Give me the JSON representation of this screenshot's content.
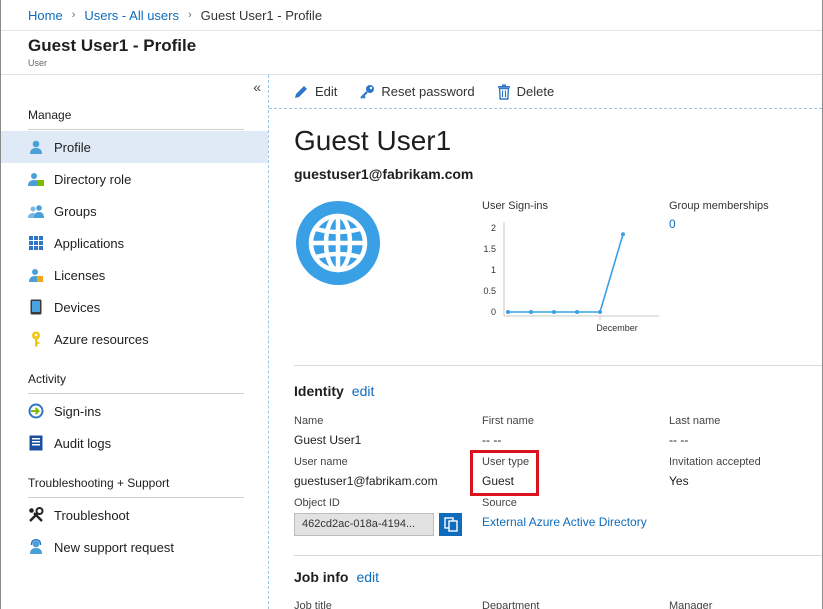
{
  "breadcrumb": {
    "home": "Home",
    "users": "Users - All users",
    "current": "Guest User1 - Profile",
    "separator": "›"
  },
  "header": {
    "title": "Guest User1 - Profile",
    "subtitle": "User"
  },
  "sidebar": {
    "collapse_label": "«",
    "sections": [
      {
        "title": "Manage"
      },
      {
        "title": "Activity"
      },
      {
        "title": "Troubleshooting + Support"
      }
    ],
    "items": [
      {
        "label": "Profile",
        "icon": "user-icon",
        "active": true
      },
      {
        "label": "Directory role",
        "icon": "role-icon"
      },
      {
        "label": "Groups",
        "icon": "groups-icon"
      },
      {
        "label": "Applications",
        "icon": "apps-grid-icon"
      },
      {
        "label": "Licenses",
        "icon": "license-icon"
      },
      {
        "label": "Devices",
        "icon": "device-icon"
      },
      {
        "label": "Azure resources",
        "icon": "key-icon"
      },
      {
        "label": "Sign-ins",
        "icon": "signin-icon"
      },
      {
        "label": "Audit logs",
        "icon": "audit-log-icon"
      },
      {
        "label": "Troubleshoot",
        "icon": "wrench-icon"
      },
      {
        "label": "New support request",
        "icon": "support-icon"
      }
    ]
  },
  "toolbar": {
    "edit": "Edit",
    "reset_password": "Reset password",
    "delete": "Delete"
  },
  "profile": {
    "display_name": "Guest User1",
    "email": "guestuser1@fabrikam.com",
    "avatar_icon": "globe-icon",
    "group_memberships_label": "Group memberships",
    "group_memberships_value": "0"
  },
  "chart_data": {
    "type": "line",
    "title": "User Sign-ins",
    "categories": [
      "",
      "",
      "",
      "",
      "December",
      ""
    ],
    "values": [
      0,
      0,
      0,
      0,
      0,
      1.85
    ],
    "xlabel": "",
    "ylabel": "",
    "ylim": [
      0,
      2
    ],
    "yticks": [
      "2",
      "1.5",
      "1",
      "0.5",
      "0"
    ],
    "grid": false,
    "color": "#3aa0e6"
  },
  "identity": {
    "title": "Identity",
    "edit": "edit",
    "fields": {
      "name_label": "Name",
      "name_value": "Guest User1",
      "first_name_label": "First name",
      "first_name_value": "-- --",
      "last_name_label": "Last name",
      "last_name_value": "-- --",
      "user_name_label": "User name",
      "user_name_value": "guestuser1@fabrikam.com",
      "user_type_label": "User type",
      "user_type_value": "Guest",
      "invitation_label": "Invitation accepted",
      "invitation_value": "Yes",
      "object_id_label": "Object ID",
      "object_id_value": "462cd2ac-018a-4194...",
      "source_label": "Source",
      "source_value": "External Azure Active Directory"
    }
  },
  "job_info": {
    "title": "Job info",
    "edit": "edit",
    "job_title_label": "Job title",
    "department_label": "Department",
    "manager_label": "Manager"
  },
  "colors": {
    "accent": "#0f6cbd",
    "highlight": "#d9121e",
    "active_bg": "#dfeaf6"
  }
}
